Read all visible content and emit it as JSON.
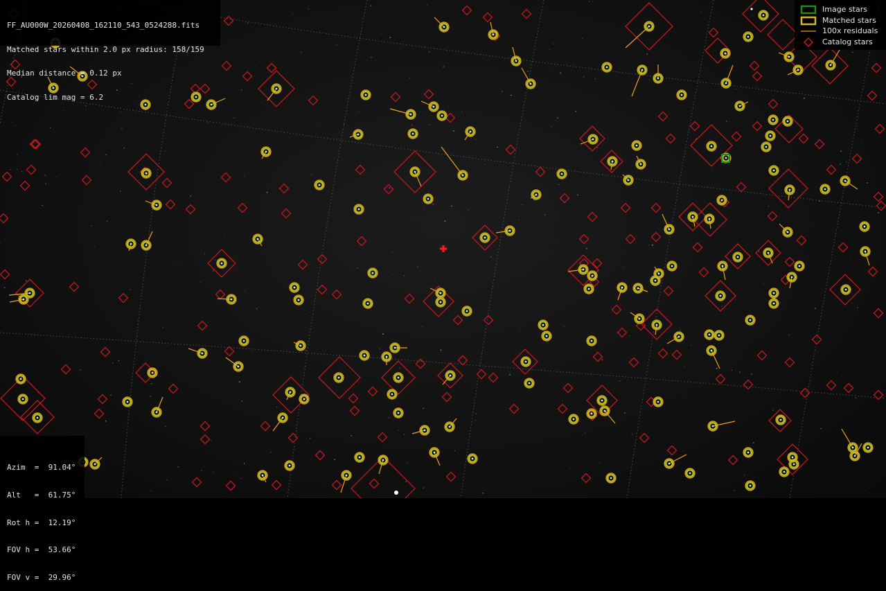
{
  "header": {
    "filename": "FF_AU000W_20260408_162110_543_0524288.fits",
    "matched_line": "Matched stars within 2.0 px radius: 158/159",
    "median_line": "Median distance = 0.12 px",
    "catalog_line": "Catalog lim mag = 6.2"
  },
  "legend": {
    "items": [
      {
        "label": "Image stars",
        "symbol": "green-square",
        "color": "#1f8a1f"
      },
      {
        "label": "Matched stars",
        "symbol": "yellow-square",
        "color": "#d7b72a"
      },
      {
        "label": "100x residuals",
        "symbol": "orange-line",
        "color": "#e8952a"
      },
      {
        "label": "Catalog stars",
        "symbol": "red-diamond",
        "color": "#d11c1c"
      }
    ]
  },
  "pointing": {
    "azim": "Azim  =  91.04°",
    "alt": "Alt   =  61.75°",
    "rot": "Rot h =  12.19°",
    "fov_h": "FOV h =  53.66°",
    "fov_v": "FOV v =  29.96°"
  },
  "colors": {
    "grid": "#6a6a6a",
    "catalog": "#c4181a",
    "matched_ring_outer": "#d2a21e",
    "matched_ring_inner": "#b9d42a",
    "residual": "#f0a020",
    "center_cross": "#ff1a1a",
    "image_box": "#1f8a1f"
  }
}
